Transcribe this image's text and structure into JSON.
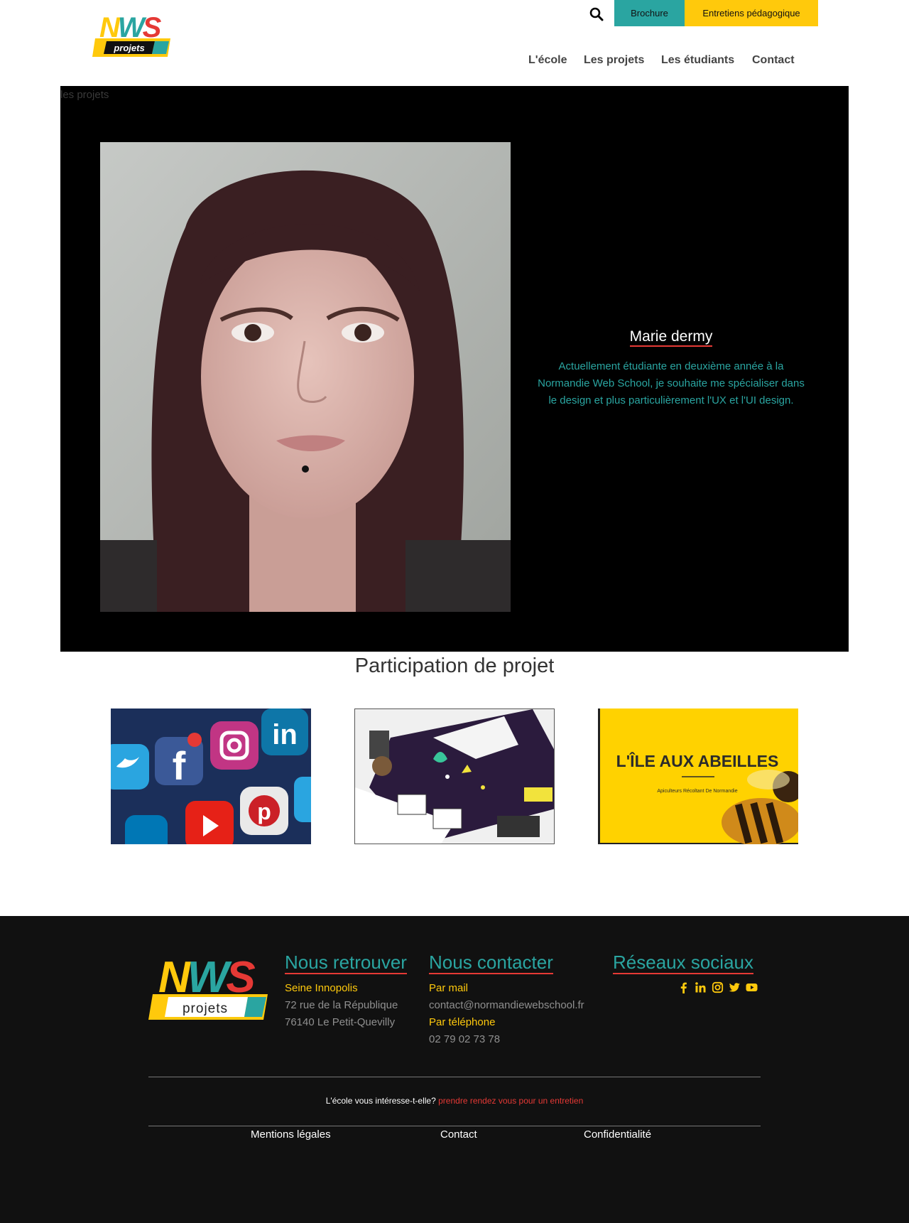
{
  "header": {
    "logo_top": "NWS",
    "logo_bottom": "projets",
    "brochure_label": "Brochure",
    "entretiens_label": "Entretiens pédagogique",
    "nav": [
      "L'école",
      "Les projets",
      "Les étudiants",
      "Contact"
    ]
  },
  "breadcrumb": "les projets",
  "student": {
    "name": "Marie dermy",
    "bio": "Actuellement étudiante en deuxième année à la Normandie Web School, je souhaite me spécialiser dans le design et plus particulièrement l'UX et l'UI design."
  },
  "projects": {
    "title": "Participation de projet",
    "cards": [
      {
        "image": "social-media-apps"
      },
      {
        "image": "design-illustration"
      },
      {
        "image": "bee-logo",
        "logo_title": "L'ÎLE AUX ABEILLES",
        "logo_subtitle": "Apiculteurs Récoltant De Normandie"
      }
    ]
  },
  "footer": {
    "col1": {
      "title": "Nous retrouver",
      "label": "Seine Innopolis",
      "line1": "72 rue de la République",
      "line2": "76140 Le Petit-Quevilly"
    },
    "col2": {
      "title": "Nous contacter",
      "mail_label": "Par mail",
      "mail": "contact@normandiewebschool.fr",
      "phone_label": "Par téléphone",
      "phone": "02 79 02 73 78"
    },
    "col3": {
      "title": "Réseaux sociaux",
      "icons": [
        "facebook-icon",
        "linkedin-icon",
        "instagram-icon",
        "twitter-icon",
        "youtube-icon"
      ]
    },
    "cta_text": "L'école vous intéresse-t-elle?",
    "cta_link": "prendre rendez vous pour un entretien",
    "links": [
      "Mentions légales",
      "Contact",
      "Confidentialité"
    ]
  },
  "colors": {
    "teal": "#2aa5a1",
    "yellow": "#ffc90c",
    "red": "#e53935",
    "footer_bg": "#111111"
  }
}
